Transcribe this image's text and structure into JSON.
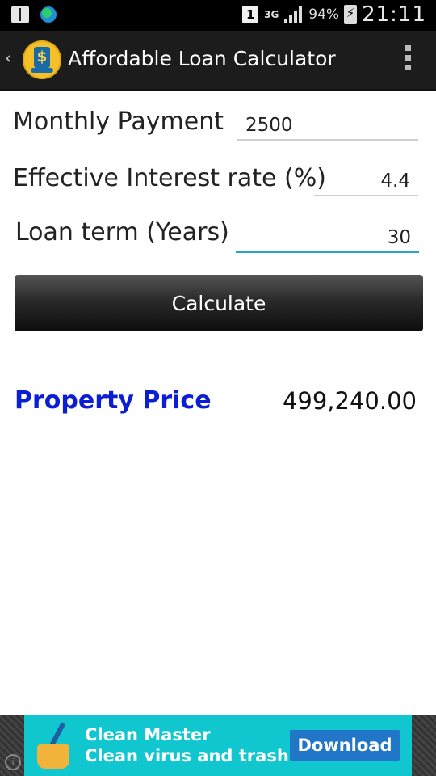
{
  "status_bar": {
    "sim_slot": "1",
    "network": "3G",
    "battery": "94%",
    "time": "21:11",
    "icons": [
      "usb-icon",
      "globe-icon",
      "sim-icon",
      "network-3g-icon",
      "signal-icon",
      "battery-charging-icon"
    ]
  },
  "action_bar": {
    "back_icon": "back-chevron-icon",
    "app_logo": "house-dollar-logo",
    "title": "Affordable Loan Calculator",
    "menu_icon": "overflow-menu-icon"
  },
  "form": {
    "monthly_payment": {
      "label": "Monthly Payment",
      "value": "2500"
    },
    "interest_rate": {
      "label": "Effective Interest rate (%)",
      "value": "4.4"
    },
    "loan_term": {
      "label": "Loan term (Years)",
      "value": "30"
    },
    "calculate_label": "Calculate"
  },
  "result": {
    "label": "Property Price",
    "value": "499,240.00",
    "label_color": "#0b1ed3"
  },
  "ad": {
    "brand": "Clean Master",
    "tagline": "Clean virus and trash!",
    "cta": "Download",
    "background": "#11c7cf",
    "cta_color": "#2176c8"
  }
}
